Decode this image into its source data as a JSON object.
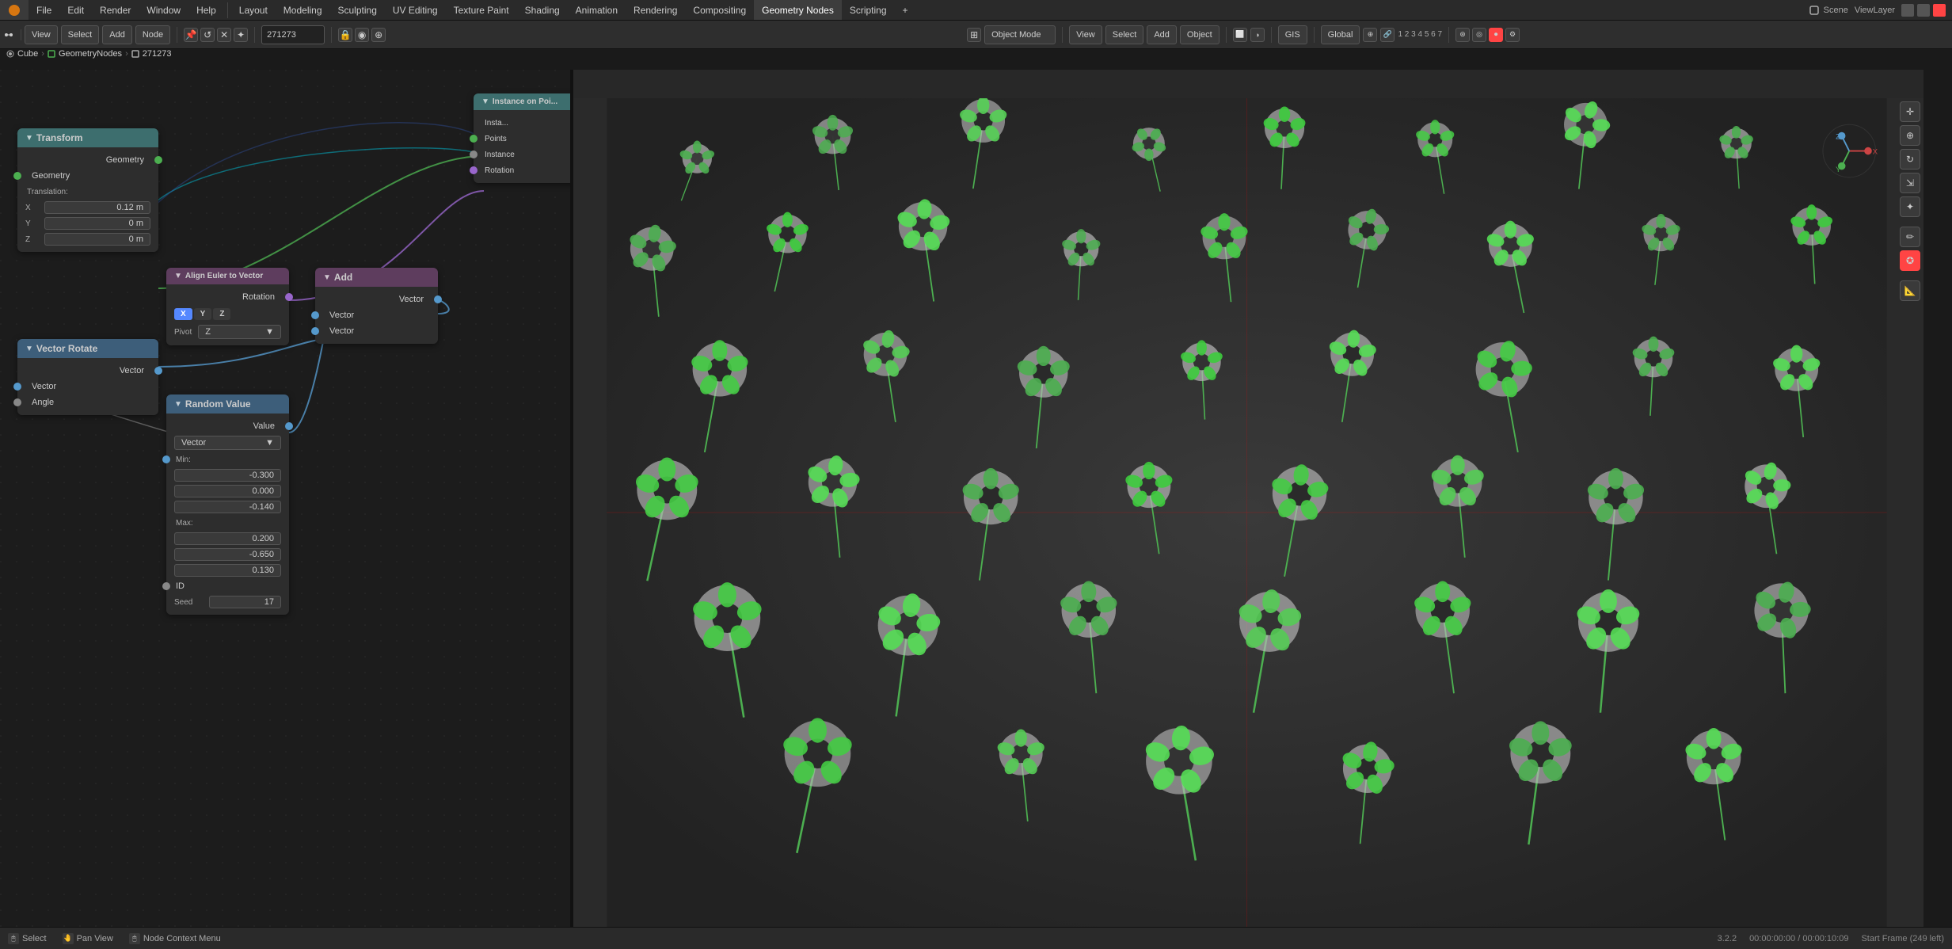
{
  "app": {
    "title": "Blender",
    "scene": "Scene",
    "view_layer": "ViewLayer"
  },
  "top_menu": {
    "items": [
      "File",
      "Edit",
      "Render",
      "Window",
      "Help",
      "Layout",
      "Modeling",
      "Sculpting",
      "UV Editing",
      "Texture Paint",
      "Shading",
      "Animation",
      "Rendering",
      "Compositing",
      "Geometry Nodes",
      "Scripting",
      "+"
    ]
  },
  "header_toolbar": {
    "view_label": "View",
    "select_label": "Select",
    "add_label": "Add",
    "node_label": "Node",
    "frame_num": "271273",
    "object_mode": "Object Mode",
    "view2": "View",
    "select2": "Select",
    "add2": "Add",
    "object2": "Object",
    "gis": "GIS",
    "global": "Global"
  },
  "breadcrumb": {
    "cube": "Cube",
    "geometry_nodes": "GeometryNodes",
    "num": "271273"
  },
  "nodes": {
    "transform": {
      "title": "Transform",
      "geometry_input": "Geometry",
      "geometry_output": "Geometry",
      "translation_label": "Translation:",
      "x_label": "X",
      "x_val": "0.12 m",
      "y_label": "Y",
      "y_val": "0 m",
      "z_label": "Z",
      "z_val": "0 m"
    },
    "vector_rotate": {
      "title": "Vector Rotate",
      "vector_input": "Vector",
      "vector_output": "Vector",
      "angle_label": "Angle"
    },
    "align_euler": {
      "title": "Align Euler to Vector",
      "rotation_output": "Rotation",
      "x_btn": "X",
      "y_btn": "Y",
      "z_btn": "Z",
      "pivot_label": "Pivot",
      "pivot_val": "Z"
    },
    "add": {
      "title": "Add",
      "vector_output": "Vector",
      "vector_input1": "Vector",
      "vector_input2": "Vector"
    },
    "random_value": {
      "title": "Random Value",
      "value_output": "Value",
      "type_val": "Vector",
      "min_label": "Min:",
      "min_x": "-0.300",
      "min_y": "0.000",
      "min_z": "-0.140",
      "max_label": "Max:",
      "max_x": "0.200",
      "max_y": "-0.650",
      "max_z": "0.130",
      "id_label": "ID",
      "seed_label": "Seed",
      "seed_val": "17"
    },
    "instance_on_points": {
      "title": "Instance on Poi...",
      "inst_label": "Insta...",
      "points_label": "Points",
      "instance_label": "Instance",
      "rotation_label": "Rotation"
    }
  },
  "status_bar": {
    "select": "Select",
    "pan_view": "Pan View",
    "node_context_menu": "Node Context Menu",
    "version": "3.2.2",
    "time": "00:00:00:00 / 00:00:10:09",
    "start_frame": "Start Frame (249 left)"
  },
  "viewport_toolbar": {
    "object_mode": "Object Mode",
    "view": "View",
    "select": "Select",
    "add": "Add",
    "object": "Object",
    "gis": "GIS",
    "global": "Global"
  }
}
